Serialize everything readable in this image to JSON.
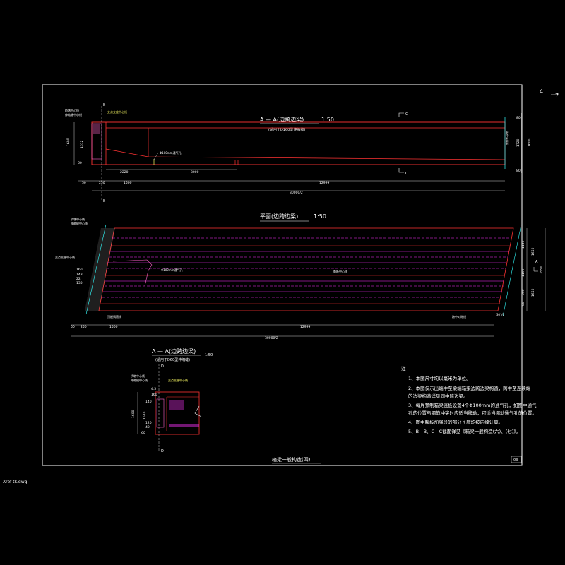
{
  "sheet": {
    "page_number": "4",
    "page_total": "7",
    "xref_label": "Xref tk.dwg",
    "drawing_title": "箱梁一般构造(四)",
    "sheet_badge": "03"
  },
  "view1": {
    "title": "A — A(边跨边梁)",
    "scale": "1:50",
    "subtitle": "(适用于D160型伸缩缝)",
    "section_b": "B",
    "section_c": "C",
    "label_support_center": "桥墩中心线",
    "label_expansion": "伸缩缝中心线",
    "label_bearing": "支点支座中心线",
    "label_vent": "Φ100mm通气孔",
    "label_symmetry": "跨中对称线",
    "dims_left": [
      "1600",
      "1512",
      "60"
    ],
    "dims_right": [
      "80",
      "1720",
      "1600",
      "80"
    ],
    "dims_bottom_top": [
      "2220",
      "3000"
    ],
    "dims_bottom": [
      "50",
      "250",
      "1500",
      "12999"
    ],
    "dims_total": "30000/2"
  },
  "view2": {
    "title": "平面(边跨边梁)",
    "scale": "1:50",
    "label_support_center": "桥墩中心线",
    "label_expansion": "伸缩缝中心线",
    "label_bearing": "支点支座中心线",
    "label_vent": "Φ100mm通气孔",
    "label_web": "腹板中心线",
    "label_stop_bar": "顶板钢筋线",
    "label_symmetry": "跨中对称线",
    "label_skew": "斜交角",
    "section_a": "A",
    "dims_left": [
      "160",
      "148",
      "22",
      "130"
    ],
    "dims_right": [
      "1150",
      "1650",
      "1190",
      "1650",
      "900",
      "700",
      "3550"
    ],
    "dims_bottom": [
      "50",
      "250",
      "1500",
      "12999"
    ],
    "dims_total": "30000/2",
    "skew_value": "30°/0"
  },
  "view3": {
    "title": "A — A(边跨边梁)",
    "scale": "1:50",
    "subtitle": "(适用于D60型伸缩缝)",
    "section_d": "D",
    "label_support_center": "桥墩中心线",
    "label_expansion": "伸缩缝中心线",
    "label_bearing": "支点支座中心线",
    "dims_left": [
      "1600",
      "1510",
      "60"
    ],
    "dims_top": [
      "4.5",
      "160"
    ],
    "dims_misc": [
      "140",
      "120",
      "40"
    ]
  },
  "notes": {
    "heading": "注",
    "items": [
      "1、本图尺寸均以毫米为单位。",
      "2、本图仅示出端中至梁端箱梁边跨边梁构造，跨中至连续端",
      "   的边梁构造详见同中跨边梁。",
      "3、每片预制箱梁底板设置4个Φ100mm的通气孔，如图中通气",
      "   孔的位置与钢筋冲突时应适当移动，可适当挪动通气孔的位置。",
      "4、图中腹板加强段的部分长度均按内缘计算。",
      "5、B—B、C—C截面详见《箱梁一般构造(六)、(七)》。"
    ]
  }
}
